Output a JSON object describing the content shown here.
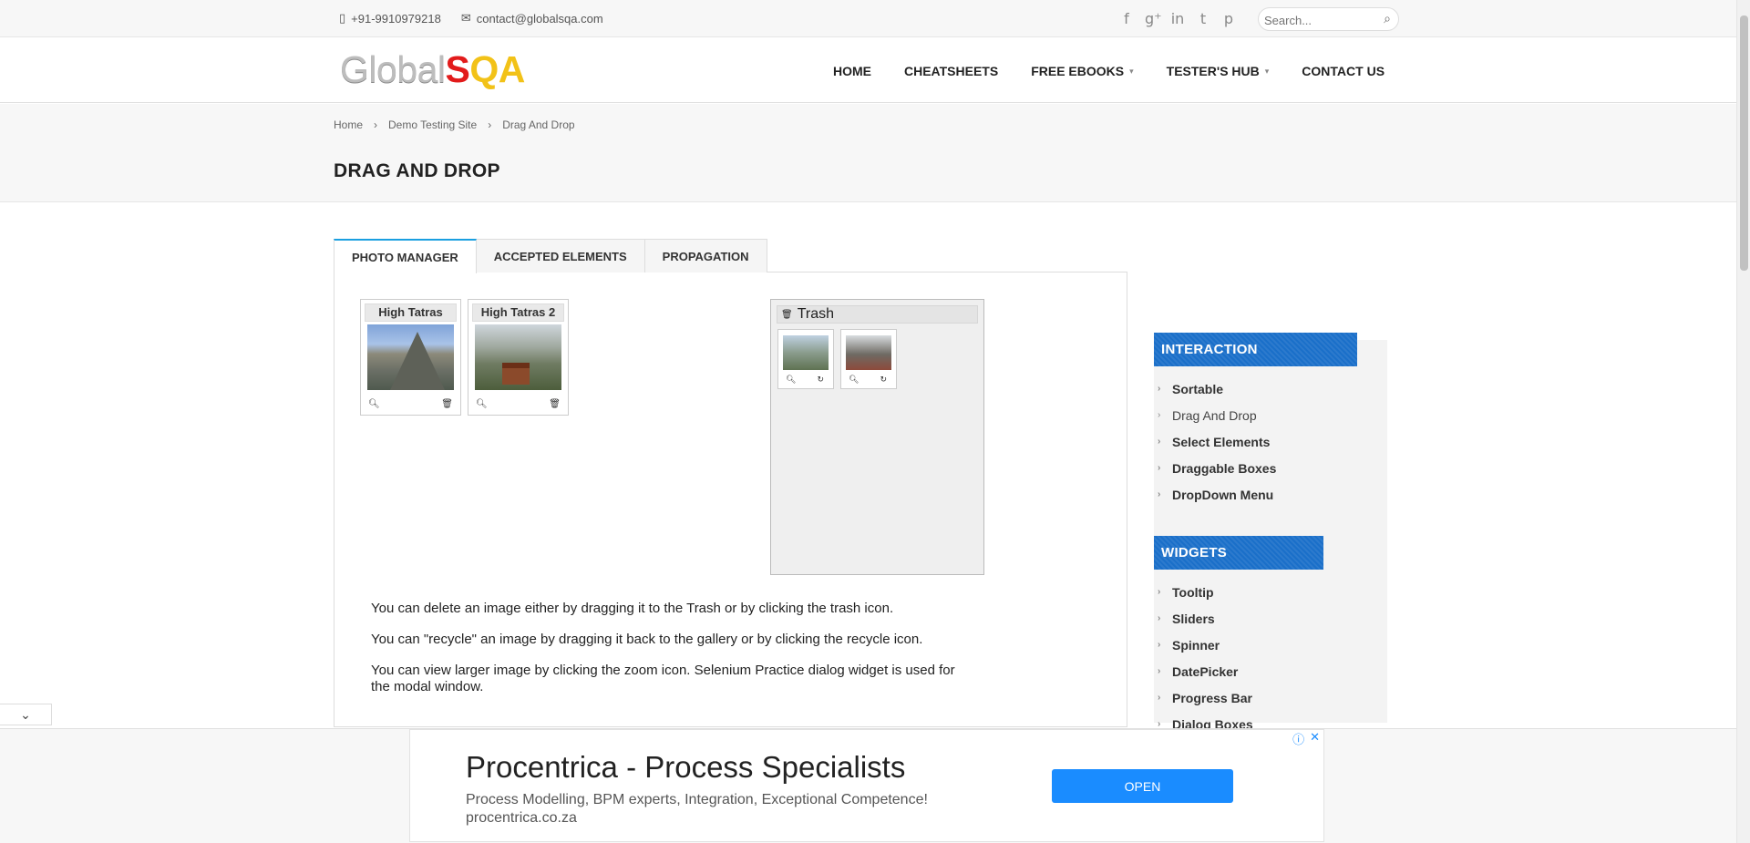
{
  "topbar": {
    "phone": "+91-9910979218",
    "email": "contact@globalsqa.com",
    "social_icons": [
      "facebook-icon",
      "google-plus-icon",
      "linkedin-icon",
      "twitter-icon",
      "pinterest-icon"
    ],
    "search_placeholder": "Search..."
  },
  "logo": {
    "part1": "Global",
    "part2": "S",
    "part3": "QA"
  },
  "nav": {
    "home": "HOME",
    "cheatsheets": "CHEATSHEETS",
    "free_ebooks": "FREE EBOOKS",
    "testers_hub": "TESTER'S HUB",
    "contact_us": "CONTACT US"
  },
  "breadcrumb": {
    "home": "Home",
    "sep": "›",
    "demo": "Demo Testing Site",
    "current": "Drag And Drop"
  },
  "page_title": "DRAG AND DROP",
  "tabs": [
    "PHOTO MANAGER",
    "ACCEPTED ELEMENTS",
    "PROPAGATION"
  ],
  "gallery": [
    {
      "title": "High Tatras"
    },
    {
      "title": "High Tatras 2"
    }
  ],
  "trash": {
    "title": "Trash"
  },
  "description": [
    "You can delete an image either by dragging it to the Trash or by clicking the trash icon.",
    "You can \"recycle\" an image by dragging it back to the gallery or by clicking the recycle icon.",
    "You can view larger image by clicking the zoom icon. Selenium Practice dialog widget is used for the modal window."
  ],
  "sidebar": {
    "interaction_title": "INTERACTION",
    "interaction_items": [
      "Sortable",
      "Drag And Drop",
      "Select Elements",
      "Draggable Boxes",
      "DropDown Menu"
    ],
    "widgets_title": "WIDGETS",
    "widget_items": [
      "Tooltip",
      "Sliders",
      "Spinner",
      "DatePicker",
      "Progress Bar",
      "Dialog Boxes"
    ]
  },
  "ad": {
    "title": "Procentrica - Process Specialists",
    "subtitle": "Process Modelling, BPM experts, Integration, Exceptional Competence!",
    "domain": "procentrica.co.za",
    "open_label": "OPEN"
  },
  "colors": {
    "accent": "#1a6fc9",
    "tab_accent": "#1a9fe0",
    "ad_button": "#1a8cff"
  }
}
